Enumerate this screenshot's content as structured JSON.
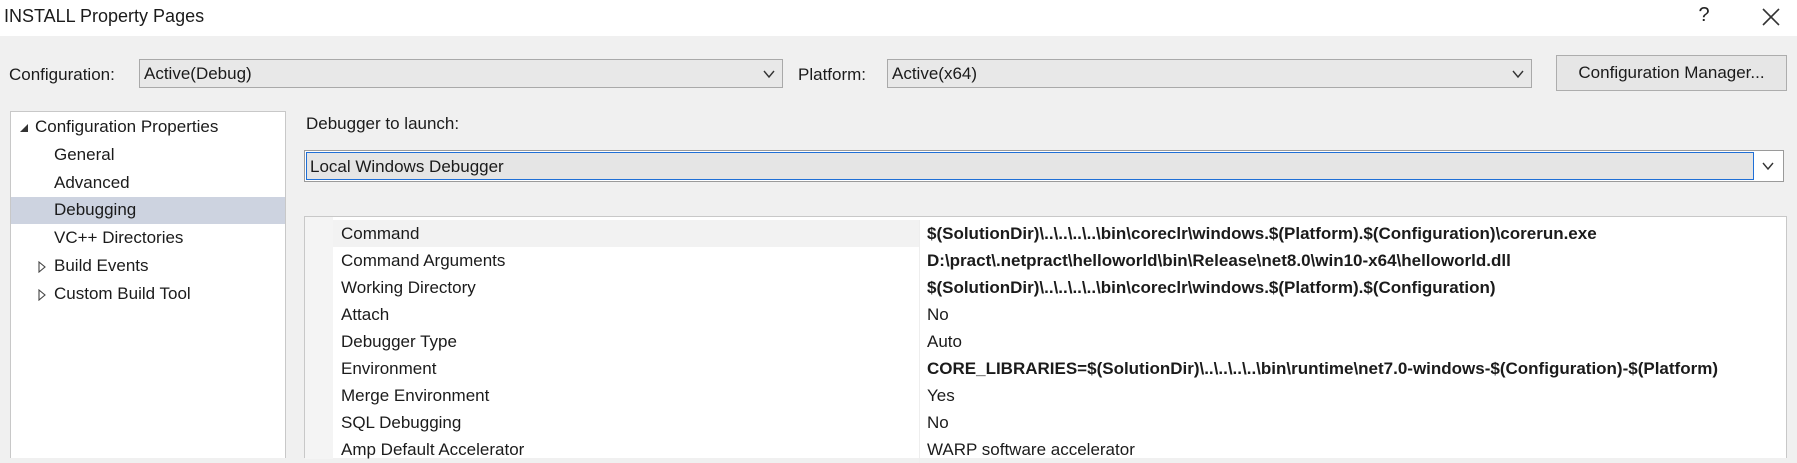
{
  "window": {
    "title": "INSTALL Property Pages",
    "help_glyph": "?",
    "close_icon": "close-icon"
  },
  "config_bar": {
    "configuration_label": "Configuration:",
    "configuration_value": "Active(Debug)",
    "platform_label": "Platform:",
    "platform_value": "Active(x64)",
    "config_manager_label": "Configuration Manager..."
  },
  "tree": {
    "root": {
      "label": "Configuration Properties",
      "expanded": true
    },
    "items": [
      {
        "label": "General",
        "selected": false,
        "expandable": false
      },
      {
        "label": "Advanced",
        "selected": false,
        "expandable": false
      },
      {
        "label": "Debugging",
        "selected": true,
        "expandable": false
      },
      {
        "label": "VC++ Directories",
        "selected": false,
        "expandable": false
      },
      {
        "label": "Build Events",
        "selected": false,
        "expandable": true
      },
      {
        "label": "Custom Build Tool",
        "selected": false,
        "expandable": true
      }
    ]
  },
  "debugger": {
    "label": "Debugger to launch:",
    "value": "Local Windows Debugger"
  },
  "properties": [
    {
      "name": "Command",
      "value": "$(SolutionDir)\\..\\..\\..\\..\\bin\\coreclr\\windows.$(Platform).$(Configuration)\\corerun.exe",
      "bold": true
    },
    {
      "name": "Command Arguments",
      "value": "D:\\pract\\.netpract\\helloworld\\bin\\Release\\net8.0\\win10-x64\\helloworld.dll",
      "bold": true
    },
    {
      "name": "Working Directory",
      "value": "$(SolutionDir)\\..\\..\\..\\..\\bin\\coreclr\\windows.$(Platform).$(Configuration)",
      "bold": true
    },
    {
      "name": "Attach",
      "value": "No",
      "bold": false
    },
    {
      "name": "Debugger Type",
      "value": "Auto",
      "bold": false
    },
    {
      "name": "Environment",
      "value": "CORE_LIBRARIES=$(SolutionDir)\\..\\..\\..\\..\\bin\\runtime\\net7.0-windows-$(Configuration)-$(Platform)",
      "bold": true
    },
    {
      "name": "Merge Environment",
      "value": "Yes",
      "bold": false
    },
    {
      "name": "SQL Debugging",
      "value": "No",
      "bold": false
    },
    {
      "name": "Amp Default Accelerator",
      "value": "WARP software accelerator",
      "bold": false
    }
  ],
  "colors": {
    "selection_bg": "#cdd3e0",
    "focus_border": "#1f6fd6"
  }
}
